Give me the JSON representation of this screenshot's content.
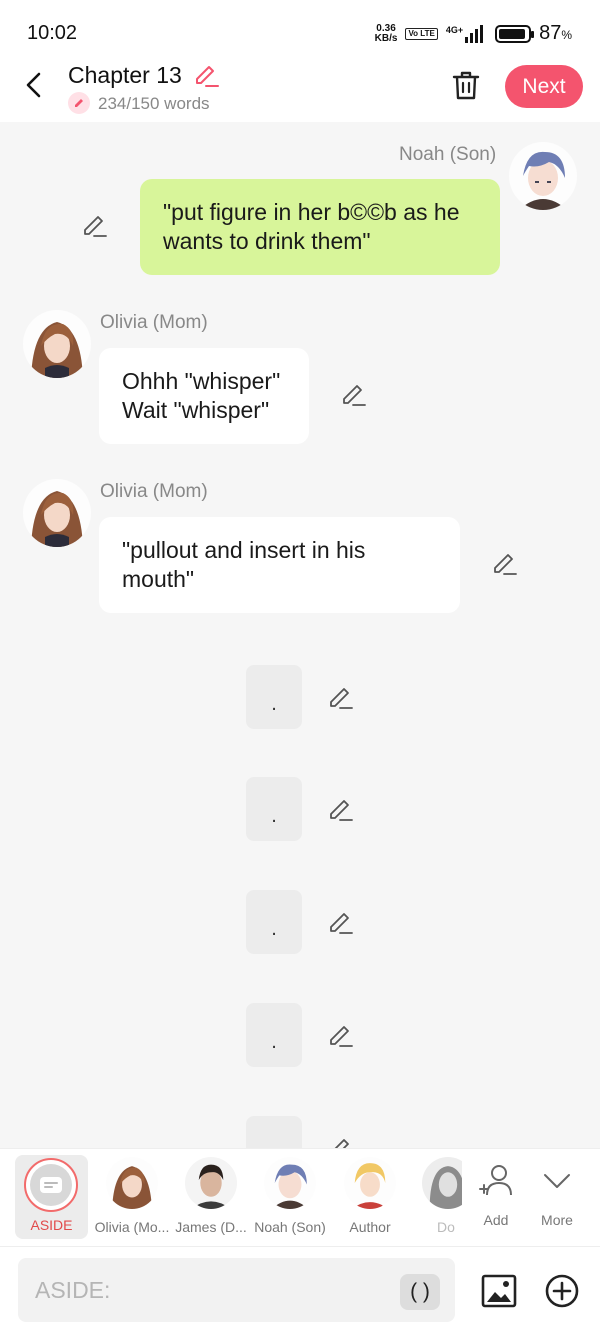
{
  "status_bar": {
    "time": "10:02",
    "net_speed": "0.36",
    "net_unit": "KB/s",
    "volte": "Vo LTE",
    "network": "4G+",
    "battery": "87",
    "battery_unit": "%"
  },
  "header": {
    "title": "Chapter 13",
    "word_count": "234/150 words",
    "next_label": "Next"
  },
  "messages": [
    {
      "speaker": "Noah (Son)",
      "text": "\"put figure in her b©©b as he wants to drink them\""
    },
    {
      "speaker": "Olivia (Mom)",
      "text": "Ohhh \"whisper\" Wait \"whisper\""
    },
    {
      "speaker": "Olivia (Mom)",
      "text": "\"pullout and insert in his mouth\""
    }
  ],
  "aside_bubbles": [
    ".",
    ".",
    ".",
    "."
  ],
  "characters": [
    {
      "label": "ASIDE"
    },
    {
      "label": "Olivia (Mo..."
    },
    {
      "label": "James (D..."
    },
    {
      "label": "Noah (Son)"
    },
    {
      "label": "Author"
    },
    {
      "label": "Do"
    }
  ],
  "utilities": {
    "add_label": "Add",
    "more_label": "More"
  },
  "input": {
    "placeholder": "ASIDE:",
    "paren_label": "( )"
  },
  "colors": {
    "accent": "#f4546e",
    "sender_bubble": "#d8f59a",
    "background": "#f6f6f6"
  }
}
